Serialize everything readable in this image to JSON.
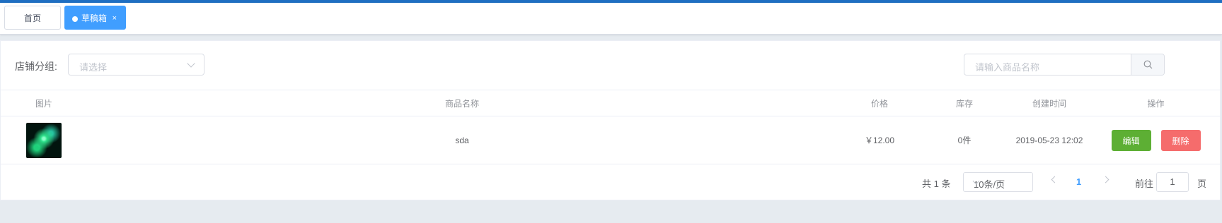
{
  "tabs": {
    "home": "首页",
    "active": "草稿箱",
    "close_symbol": "×"
  },
  "filter": {
    "store_group_label": "店铺分组:",
    "store_group_placeholder": "请选择"
  },
  "search": {
    "placeholder": "请输入商品名称",
    "icon": "search-icon"
  },
  "table": {
    "columns": [
      "图片",
      "商品名称",
      "价格",
      "库存",
      "创建时间",
      "操作"
    ],
    "rows": [
      {
        "name": "sda",
        "price": "￥12.00",
        "stock": "0件",
        "created": "2019-05-23 12:02",
        "edit": "编辑",
        "delete": "删除"
      }
    ]
  },
  "pagination": {
    "total": "共 1 条",
    "page_size": "10条/页",
    "current_page": "1",
    "goto_label": "前往",
    "goto_value": "1",
    "page_unit": "页"
  },
  "colors": {
    "primary": "#409eff",
    "success": "#5daf34",
    "danger": "#f56c6c",
    "topbar": "#1f6fc2"
  }
}
